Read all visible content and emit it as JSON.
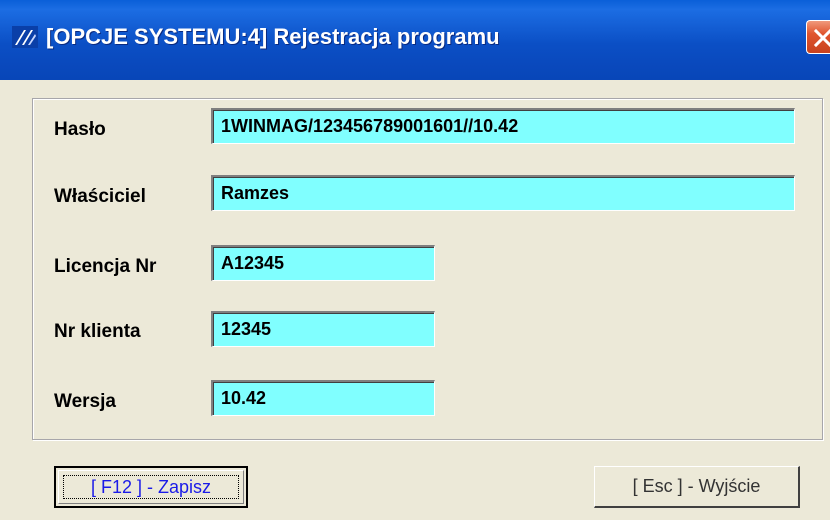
{
  "window": {
    "title": "[OPCJE SYSTEMU:4]  Rejestracja programu"
  },
  "form": {
    "haslo_label": "Hasło",
    "haslo_value": "1WINMAG/123456789001601//10.42",
    "wlasciciel_label": "Właściciel",
    "wlasciciel_value": "Ramzes",
    "licencja_label": "Licencja Nr",
    "licencja_value": "A12345",
    "klient_label": "Nr klienta",
    "klient_value": "12345",
    "wersja_label": "Wersja",
    "wersja_value": "10.42"
  },
  "buttons": {
    "save_label": "[ F12 ] - Zapisz",
    "exit_label": "[ Esc ] - Wyjście"
  },
  "icons": {
    "app": "app-logo-icon",
    "close": "close-icon"
  },
  "colors": {
    "titlebar": "#0B4FC5",
    "field_bg": "#80FFFF",
    "dialog_bg": "#ECE9D8",
    "save_text": "#1B1BE8",
    "close_button": "#E0552E"
  }
}
